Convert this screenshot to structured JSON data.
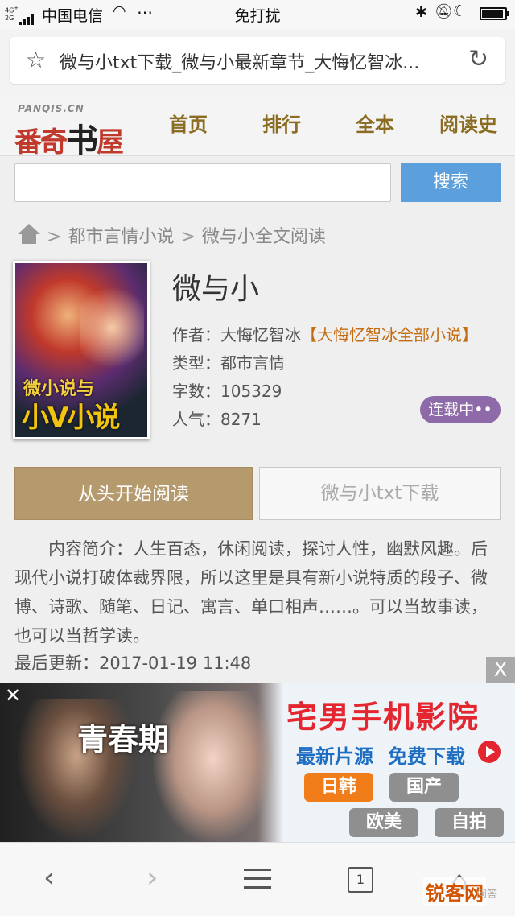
{
  "status_bar": {
    "network": "4G⁺\n2G",
    "carrier": "中国电信",
    "wifi_icon": "wifi-icon",
    "more": "⋯",
    "mode": "免打扰",
    "bluetooth": "✱",
    "bell": "⍾",
    "moon": "☾"
  },
  "browser": {
    "url_text": "微与小txt下载_微与小最新章节_大悔忆智冰...",
    "star": "☆",
    "reload": "↻"
  },
  "site": {
    "logo_small": "PANQIS.CN",
    "logo_text_red": "番奇",
    "logo_text_ink": "书",
    "logo_text_red2": "屋",
    "nav": [
      {
        "label": "首页"
      },
      {
        "label": "排行"
      },
      {
        "label": "全本"
      },
      {
        "label": "阅读史"
      }
    ]
  },
  "search": {
    "placeholder": "",
    "button_label": "搜索"
  },
  "breadcrumb": {
    "sep": ">",
    "items": [
      {
        "label": "都市言情小说"
      },
      {
        "label": "微与小全文阅读"
      }
    ]
  },
  "book": {
    "cover_title_line1": "微小说与",
    "cover_title_line2": "小V小说",
    "title": "微与小",
    "author_label": "作者：",
    "author": "大悔忆智冰",
    "author_link": "【大悔忆智冰全部小说】",
    "type_label": "类型：",
    "type": "都市言情",
    "words_label": "字数：",
    "words": "105329",
    "popularity_label": "人气：",
    "popularity": "8271",
    "status": "连载中••"
  },
  "actions": {
    "read_label": "从头开始阅读",
    "download_label": "微与小txt下载"
  },
  "intro": {
    "text": "内容简介：人生百态，休闲阅读，探讨人性，幽默风趣。后现代小说打破体裁界限，所以这里是具有新小说特质的段子、微博、诗歌、随笔、日记、寓言、单口相声……。可以当故事读，也可以当哲学读。",
    "updated_label": "最后更新：",
    "updated": "2017-01-19 11:48"
  },
  "ad": {
    "close_top": "X",
    "close_left": "✕",
    "youth_text": "青春期",
    "headline": "宅男手机影院",
    "sub1": "最新片源",
    "sub2": "免费下载",
    "tags": [
      {
        "label": "日韩",
        "color": "#f07d1a"
      },
      {
        "label": "国产",
        "color": "#8f8f8f"
      },
      {
        "label": "欧美",
        "color": "#8f8f8f"
      },
      {
        "label": "自拍",
        "color": "#8f8f8f"
      }
    ]
  },
  "bottom_nav": {
    "back": "‹",
    "forward": "›",
    "tabs_count": "1",
    "home": "⌂"
  },
  "watermark": {
    "brand": "锐客网",
    "sub": "问答"
  }
}
